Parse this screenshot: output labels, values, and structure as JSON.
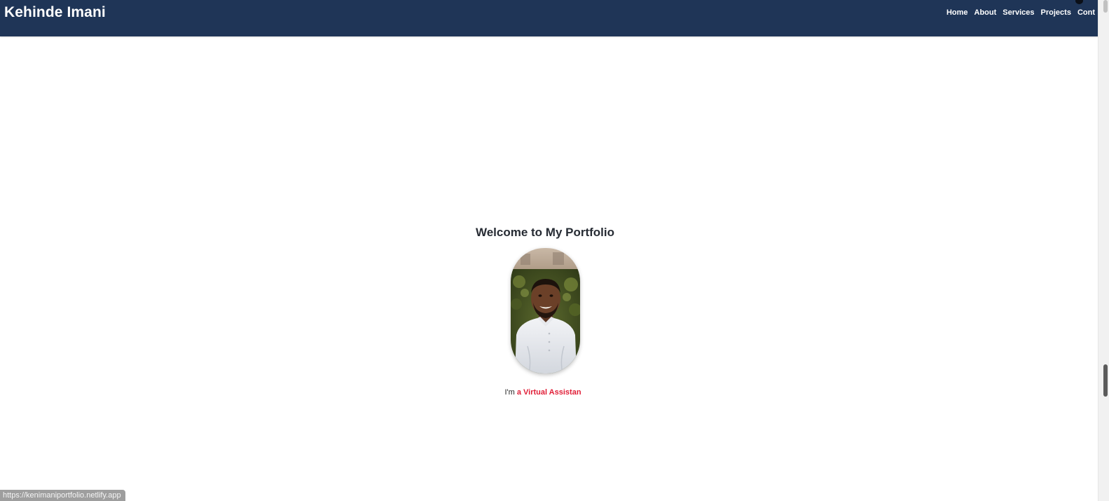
{
  "header": {
    "brand": "Kehinde Imani",
    "nav": [
      "Home",
      "About",
      "Services",
      "Projects",
      "Cont"
    ]
  },
  "hero": {
    "title": "Welcome to My Portfolio",
    "photo_alt": "Portrait photo",
    "tagline_prefix": "I'm",
    "tagline_role": "a Virtual Assistan"
  },
  "status_bar": {
    "url": "https://kenimaniportfolio.netlify.app"
  },
  "colors": {
    "navbar": "#1f3557",
    "accent": "#e01e37",
    "heading": "#262b33"
  }
}
